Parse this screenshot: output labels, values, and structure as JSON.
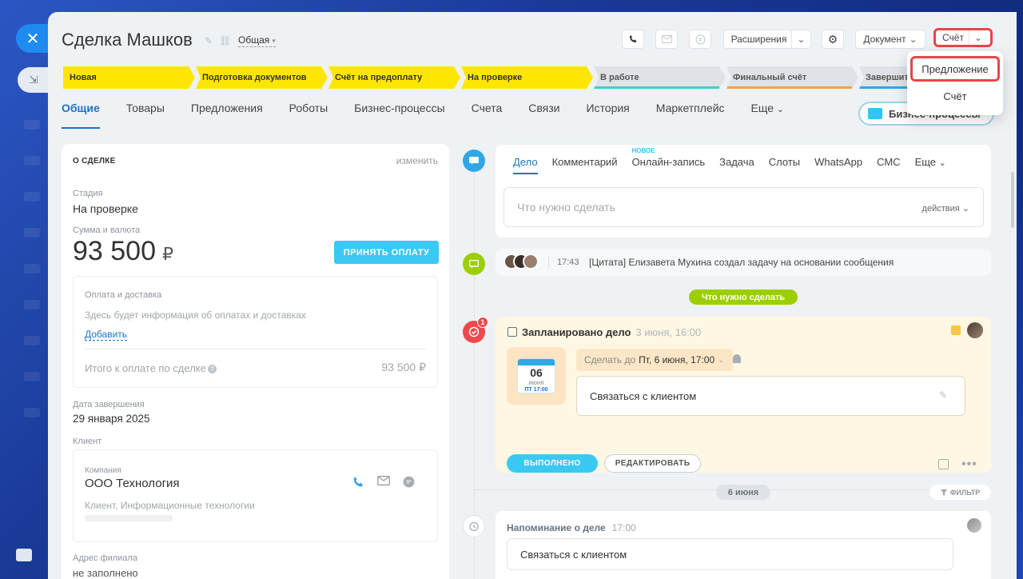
{
  "header": {
    "title": "Сделка Машков",
    "pipeline": "Общая",
    "extensions_label": "Расширения",
    "document_label": "Документ",
    "invoice_label": "Счёт"
  },
  "dropdown": {
    "items": [
      "Предложение",
      "Счёт"
    ]
  },
  "stages": [
    {
      "label": "Новая",
      "status": "done"
    },
    {
      "label": "Подготовка документов",
      "status": "done"
    },
    {
      "label": "Счёт на предоплату",
      "status": "done"
    },
    {
      "label": "На проверке",
      "status": "done"
    },
    {
      "label": "В работе",
      "status": "todo",
      "color": "#3fd0c5"
    },
    {
      "label": "Финальный счёт",
      "status": "todo",
      "color": "#f1a34a"
    },
    {
      "label": "Завершит",
      "status": "todo",
      "color": "#2fa7e6"
    }
  ],
  "tabs": [
    "Общие",
    "Товары",
    "Предложения",
    "Роботы",
    "Бизнес-процессы",
    "Счета",
    "Связи",
    "История",
    "Маркетплейс",
    "Еще"
  ],
  "bp_button": "Бизнес-процессы",
  "about": {
    "title": "О СДЕЛКЕ",
    "edit": "изменить",
    "stage_label": "Стадия",
    "stage_value": "На проверке",
    "amount_label": "Сумма и валюта",
    "amount": "93 500",
    "currency": "₽",
    "accept_btn": "ПРИНЯТЬ ОПЛАТУ",
    "payment": {
      "title": "Оплата и доставка",
      "desc": "Здесь будет информация об оплатах и доставках",
      "add": "Добавить",
      "total_label": "Итого к оплате по сделке",
      "total_value": "93 500 ₽"
    },
    "close_date_label": "Дата завершения",
    "close_date": "29 января 2025",
    "client_label": "Клиент",
    "client": {
      "type": "Компания",
      "name": "ООО Технология",
      "desc": "Клиент, Информационные технологии"
    },
    "branch_label": "Адрес филиала",
    "branch_value": "не заполнено"
  },
  "editor": {
    "tabs": [
      "Дело",
      "Комментарий",
      "Онлайн-запись",
      "Задача",
      "Слоты",
      "WhatsApp",
      "СМС",
      "Еще"
    ],
    "new_badge": "НОВОЕ",
    "placeholder": "Что нужно сделать",
    "actions": "действия"
  },
  "feed": {
    "quote_time": "17:43",
    "quote_text": "[Цитата] Елизавета Мухина создал задачу на основании сообщения",
    "todo_pill": "Что нужно сделать",
    "deal": {
      "badge": "1",
      "title": "Запланировано дело",
      "date": "3 июня, 16:00",
      "cal_day": "06",
      "cal_month": "июня",
      "cal_time": "ПТ 17:00",
      "deadline_label": "Сделать до",
      "deadline_value": "Пт, 6 июня, 17:00",
      "text": "Связаться с клиентом",
      "done_btn": "ВЫПОЛНЕНО",
      "edit_btn": "РЕДАКТИРОВАТЬ"
    },
    "date_pill": "6 июня",
    "filter": "ФИЛЬТР",
    "reminder": {
      "title": "Напоминание о деле",
      "time": "17:00",
      "text": "Связаться с клиентом"
    }
  },
  "colors": {
    "accent": "#1a73c8",
    "stage_done": "#ffe600",
    "highlight": "#e8464a",
    "action_btn": "#3bc8f5",
    "green": "#9dcf00"
  }
}
